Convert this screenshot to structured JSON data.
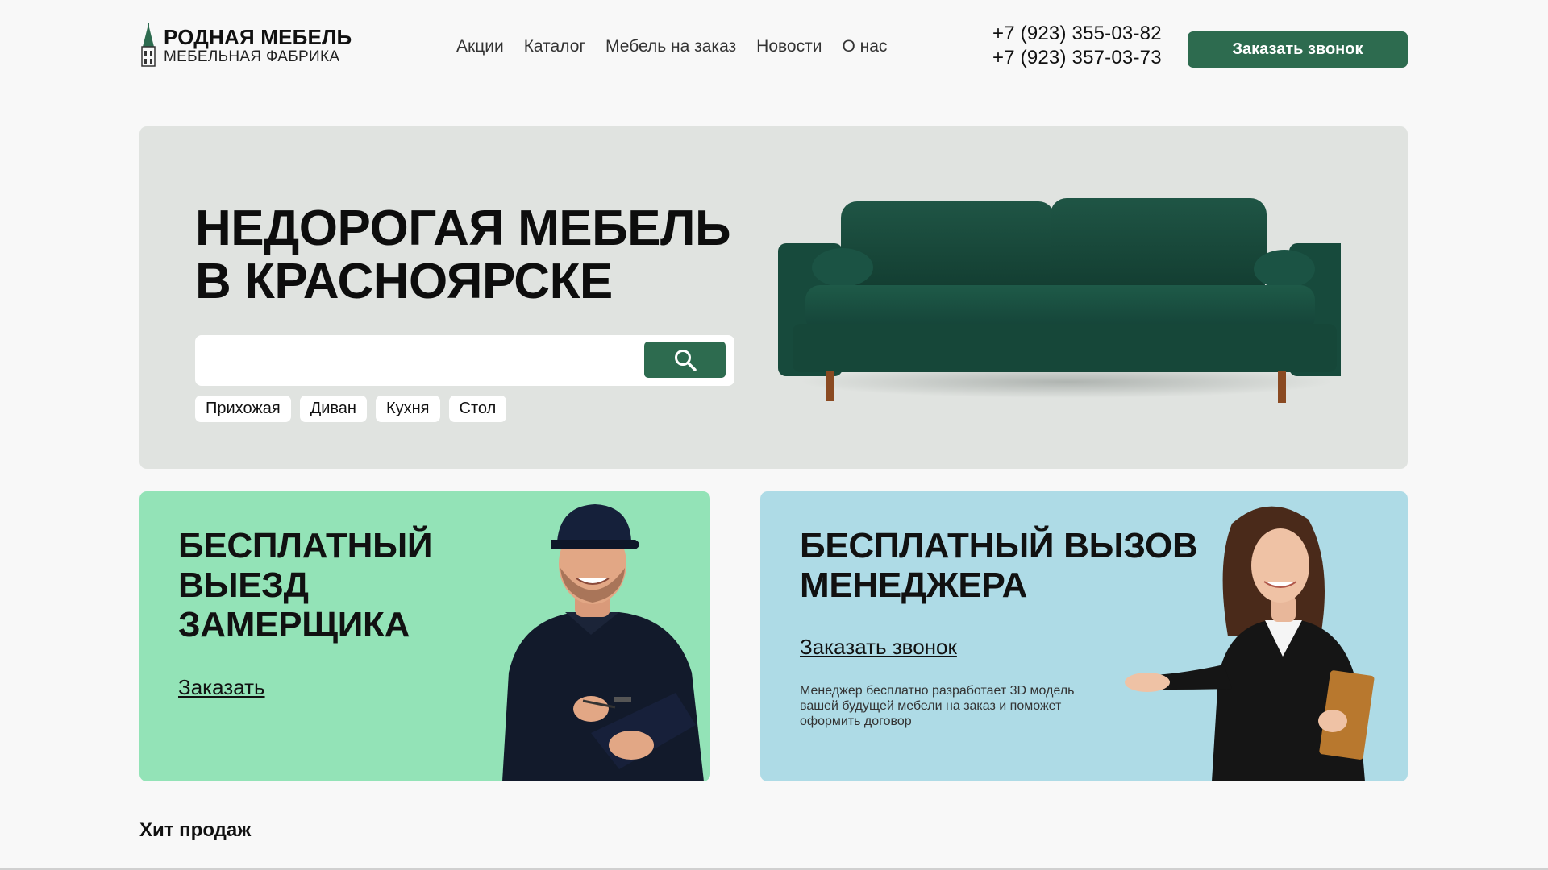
{
  "header": {
    "logo": {
      "title": "РОДНАЯ МЕБЕЛЬ",
      "subtitle": "МЕБЕЛЬНАЯ ФАБРИКА"
    },
    "nav": [
      {
        "label": "Акции"
      },
      {
        "label": "Каталог"
      },
      {
        "label": "Мебель на заказ"
      },
      {
        "label": "Новости"
      },
      {
        "label": "О нас"
      }
    ],
    "phones": [
      "+7 (923) 355-03-82",
      "+7 (923) 357-03-73"
    ],
    "callback_label": "Заказать звонок"
  },
  "hero": {
    "title_line1": "НЕДОРОГАЯ МЕБЕЛЬ",
    "title_line2": "В КРАСНОЯРСКЕ",
    "search_placeholder": "",
    "search_icon": "search-icon",
    "tags": [
      "Прихожая",
      "Диван",
      "Кухня",
      "Стол"
    ]
  },
  "promos": {
    "measurer": {
      "title_line1": "БЕСПЛАТНЫЙ",
      "title_line2": "ВЫЕЗД",
      "title_line3": "ЗАМЕРЩИКА",
      "link": "Заказать"
    },
    "manager": {
      "title_line1": "БЕСПЛАТНЫЙ ВЫЗОВ",
      "title_line2": "МЕНЕДЖЕРА",
      "link": "Заказать звонок",
      "description": "Менеджер бесплатно разработает 3D модель вашей будущей мебели на заказ и поможет оформить договор"
    }
  },
  "bestsellers": {
    "title": "Хит продаж"
  },
  "colors": {
    "accent": "#2d6b4f",
    "hero_bg": "#e0e3e0",
    "promo_green": "#93e3b7",
    "promo_blue": "#aedbe6"
  }
}
